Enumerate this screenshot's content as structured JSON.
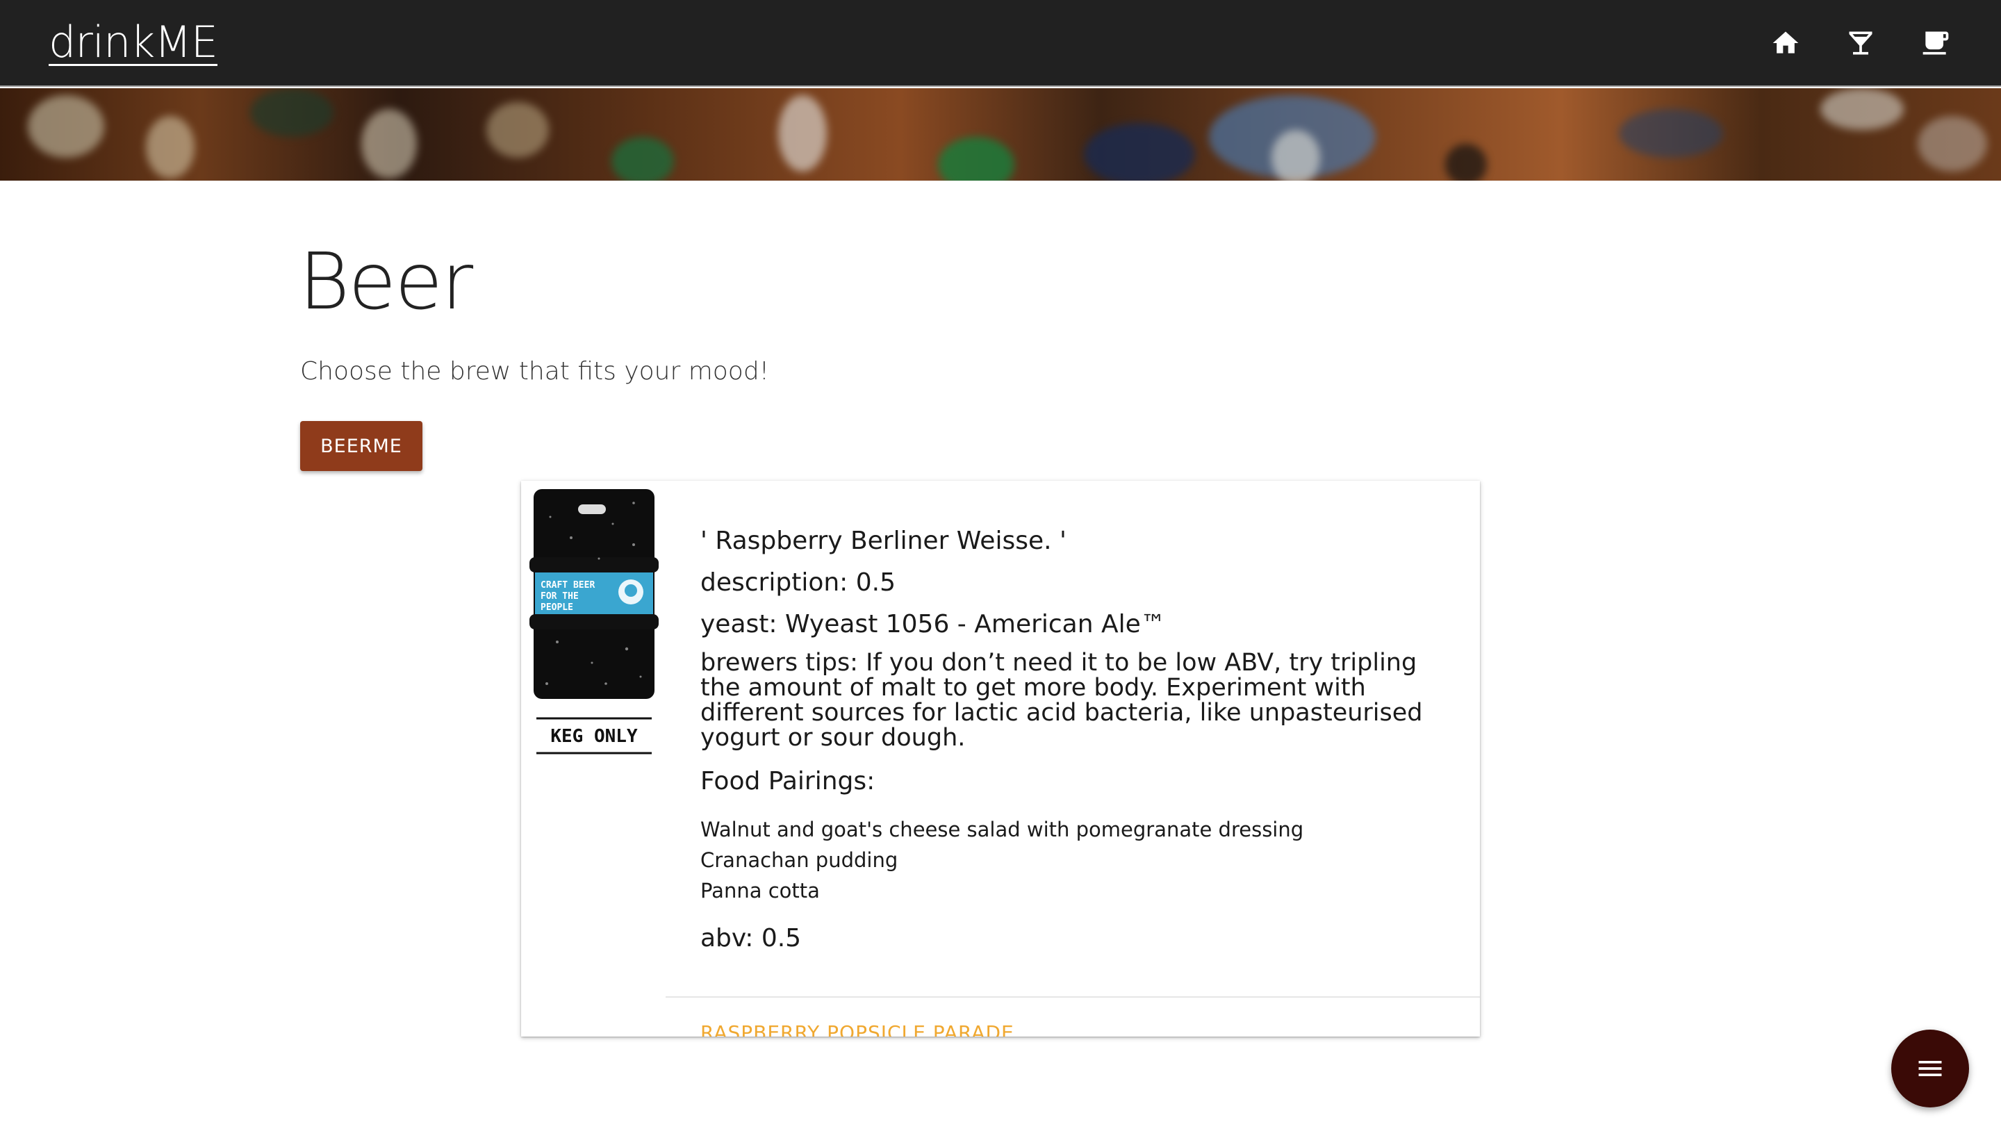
{
  "navbar": {
    "brand": "drinkME",
    "icons": [
      "home-icon",
      "cocktail-icon",
      "coffee-cup-icon"
    ]
  },
  "page": {
    "title": "Beer",
    "subtitle": "Choose the brew that fits your mood!",
    "beerme_label": "BEERME"
  },
  "beer": {
    "name": "' Raspberry Berliner Weisse. '",
    "description": "description: 0.5",
    "yeast": "yeast: Wyeast 1056 - American Ale™",
    "brewers_tips": "brewers tips: If you don’t need it to be low ABV, try tripling the amount of malt to get more body. Experiment with different sources for lactic acid bacteria, like unpasteurised yogurt or sour dough.",
    "food_pairings_title": "Food Pairings:",
    "food_pairings": [
      "Walnut and goat's cheese salad with pomegranate dressing",
      "Cranachan pudding",
      "Panna cotta"
    ],
    "abv": "abv: 0.5",
    "image_label": "KEG ONLY",
    "image_sticker_text": "CRAFT BEER FOR THE PEOPLE"
  },
  "next_beer_link": "RASPBERRY POPSICLE PARADE",
  "colors": {
    "navbar": "#212121",
    "button": "#8f3b1b",
    "fab": "#3a0a06",
    "link": "#f0a830"
  }
}
